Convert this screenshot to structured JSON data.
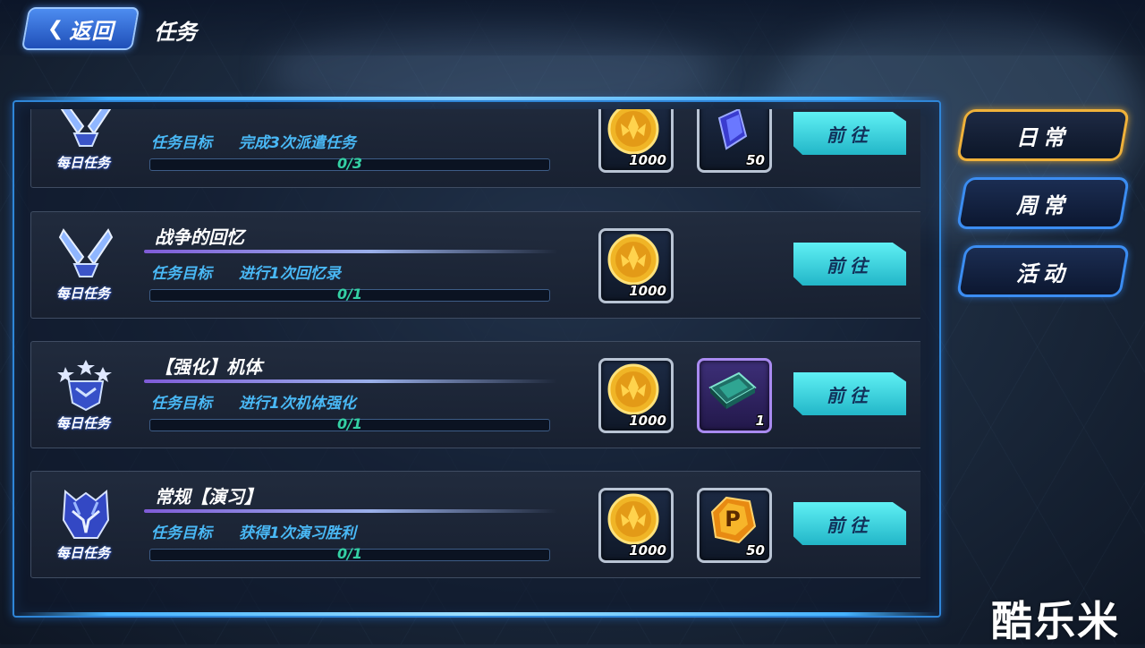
{
  "header": {
    "back_label": "返回",
    "title": "任务"
  },
  "tabs": [
    {
      "label": "日常",
      "active": true
    },
    {
      "label": "周常",
      "active": false
    },
    {
      "label": "活动",
      "active": false
    }
  ],
  "tasks": [
    {
      "name": "",
      "tag": "每日任务",
      "goal_label": "任务目标",
      "goal": "完成3次派遣任务",
      "progress": "0/3",
      "progress_fraction": 0,
      "icon": "crossed-swords-icon",
      "coin_qty": "1000",
      "item_qty": "50",
      "item": "blue-crystal-icon",
      "button": "前往"
    },
    {
      "name": "战争的回忆",
      "tag": "每日任务",
      "goal_label": "任务目标",
      "goal": "进行1次回忆录",
      "progress": "0/1",
      "progress_fraction": 0,
      "icon": "crossed-swords-icon",
      "coin_qty": "1000",
      "item_qty": "",
      "item": "",
      "button": "前往"
    },
    {
      "name": "【强化】机体",
      "tag": "每日任务",
      "goal_label": "任务目标",
      "goal": "进行1次机体强化",
      "progress": "0/1",
      "progress_fraction": 0,
      "icon": "star-emblem-icon",
      "coin_qty": "1000",
      "item_qty": "1",
      "item": "chip-card-icon",
      "button": "前往"
    },
    {
      "name": "常规【演习】",
      "tag": "每日任务",
      "goal_label": "任务目标",
      "goal": "获得1次演习胜利",
      "progress": "0/1",
      "progress_fraction": 0,
      "icon": "mech-helmet-icon",
      "coin_qty": "1000",
      "item_qty": "50",
      "item": "p-gem-icon",
      "button": "前往"
    }
  ],
  "watermark": "酷乐米",
  "colors": {
    "accent": "#3b8df2",
    "active_tab": "#f0b23a",
    "go_button": "#3ee0ea",
    "goal_text": "#49b8f5",
    "progress_text": "#34d1a4"
  }
}
